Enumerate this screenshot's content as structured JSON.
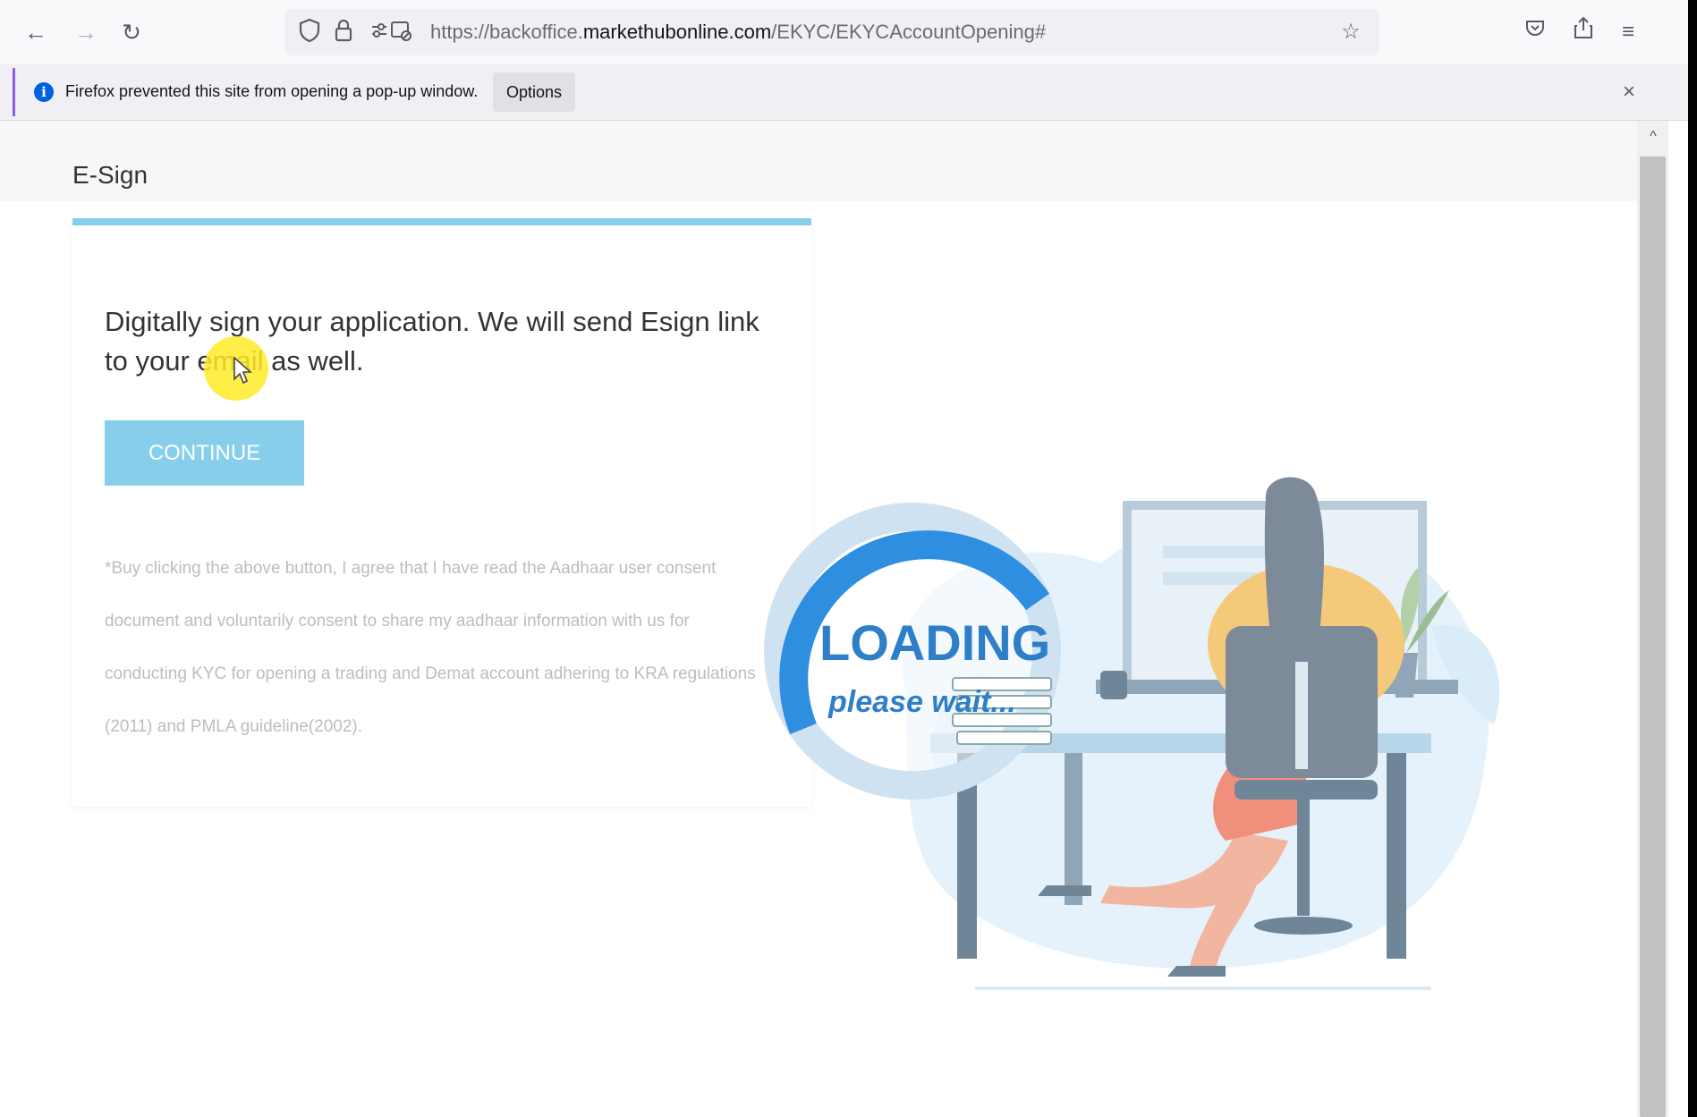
{
  "browser": {
    "url_prefix": "https://backoffice.",
    "url_domain": "markethubonline.com",
    "url_path": "/EKYC/EKYCAccountOpening#",
    "icons": {
      "back": "back-arrow-icon",
      "forward": "forward-arrow-icon",
      "reload": "reload-icon",
      "shield": "tracking-protection-icon",
      "lock": "lock-icon",
      "permissions": "permissions-icon",
      "bookmark": "star-icon",
      "pocket": "pocket-icon",
      "share": "share-icon",
      "menu": "hamburger-menu-icon"
    }
  },
  "notification": {
    "message": "Firefox prevented this site from opening a pop-up window.",
    "options_label": "Options",
    "close_icon": "close-icon",
    "accent_color": "#8a5cf5"
  },
  "esign": {
    "title": "E-Sign",
    "lead_text": "Digitally sign your application. We will send Esign link to your email as well.",
    "continue_label": "CONTINUE",
    "disclaimer": "*Buy clicking the above button, I agree that I have read the Aadhaar user consent document and voluntarily consent to share my aadhaar information with us for conducting KYC for opening a trading and Demat account adhering to KRA regulations (2011) and PMLA guideline(2002).",
    "accent_color": "#87ceeb"
  },
  "loading": {
    "title": "LOADING",
    "subtitle": "please wait...",
    "color": "#1e7fd6"
  }
}
